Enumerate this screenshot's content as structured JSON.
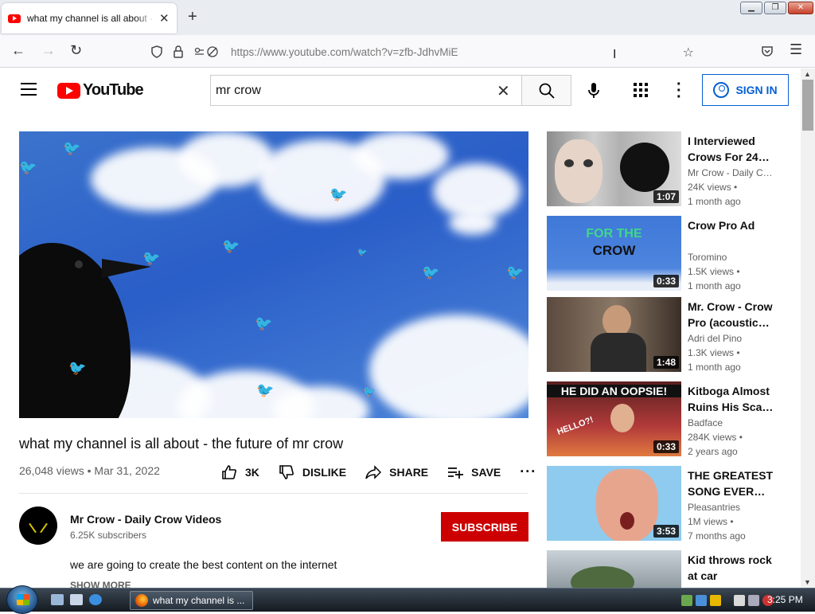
{
  "browser": {
    "tab_title": "what my channel is all about - the future of mr crow",
    "url": "https://www.youtube.com/watch?v=zfb-JdhvMiE"
  },
  "youtube": {
    "logo_text": "YouTube",
    "search_value": "mr crow",
    "signin_label": "SIGN IN"
  },
  "video": {
    "title": "what my channel is all about - the future of mr crow",
    "views": "26,048 views",
    "date": "Mar 31, 2022",
    "like_count": "3K",
    "dislike_label": "DISLIKE",
    "share_label": "SHARE",
    "save_label": "SAVE",
    "channel_name": "Mr Crow - Daily Crow Videos",
    "subscribers": "6.25K subscribers",
    "subscribe_label": "SUBSCRIBE",
    "description": "we are going to create the best content on the internet",
    "show_more": "SHOW MORE"
  },
  "related": [
    {
      "title": "I Interviewed Crows For 24…",
      "channel": "Mr Crow - Daily C…",
      "views": "24K views •",
      "ago": "1 month ago",
      "duration": "1:07"
    },
    {
      "title": "Crow Pro Ad",
      "channel": "Toromino",
      "views": "1.5K views •",
      "ago": "1 month ago",
      "duration": "0:33",
      "thumb_text_1": "FOR THE",
      "thumb_text_2": "CROW"
    },
    {
      "title": "Mr. Crow - Crow Pro (acoustic…",
      "channel": "Adri del Pino",
      "views": "1.3K views •",
      "ago": "1 month ago",
      "duration": "1:48"
    },
    {
      "title": "Kitboga Almost Ruins His Sca…",
      "channel": "Badface",
      "views": "284K views •",
      "ago": "2 years ago",
      "duration": "0:33",
      "thumb_text_1": "HE DID AN OOPSIE!",
      "thumb_text_2": "HELLO?!"
    },
    {
      "title": "THE GREATEST SONG EVER…",
      "channel": "Pleasantries",
      "views": "1M views •",
      "ago": "7 months ago",
      "duration": "3:53"
    },
    {
      "title": "Kid throws rock at car",
      "channel": "",
      "views": "",
      "ago": "",
      "duration": ""
    }
  ],
  "taskbar": {
    "task_label": "what my channel is ...",
    "clock": "3:25 PM"
  },
  "colors": {
    "youtube_red": "#ff0000",
    "subscribe_red": "#cc0000",
    "link_blue": "#065fd4"
  },
  "icons": [
    "youtube-favicon",
    "close-icon",
    "plus-icon",
    "back-icon",
    "forward-icon",
    "reload-icon",
    "shield-icon",
    "lock-icon",
    "permissions-icon",
    "star-icon",
    "pocket-icon",
    "hamburger-icon",
    "search-icon",
    "mic-icon",
    "apps-icon",
    "more-vert-icon",
    "account-icon",
    "like-icon",
    "dislike-icon",
    "share-icon",
    "playlist-add-icon",
    "more-horiz-icon"
  ]
}
